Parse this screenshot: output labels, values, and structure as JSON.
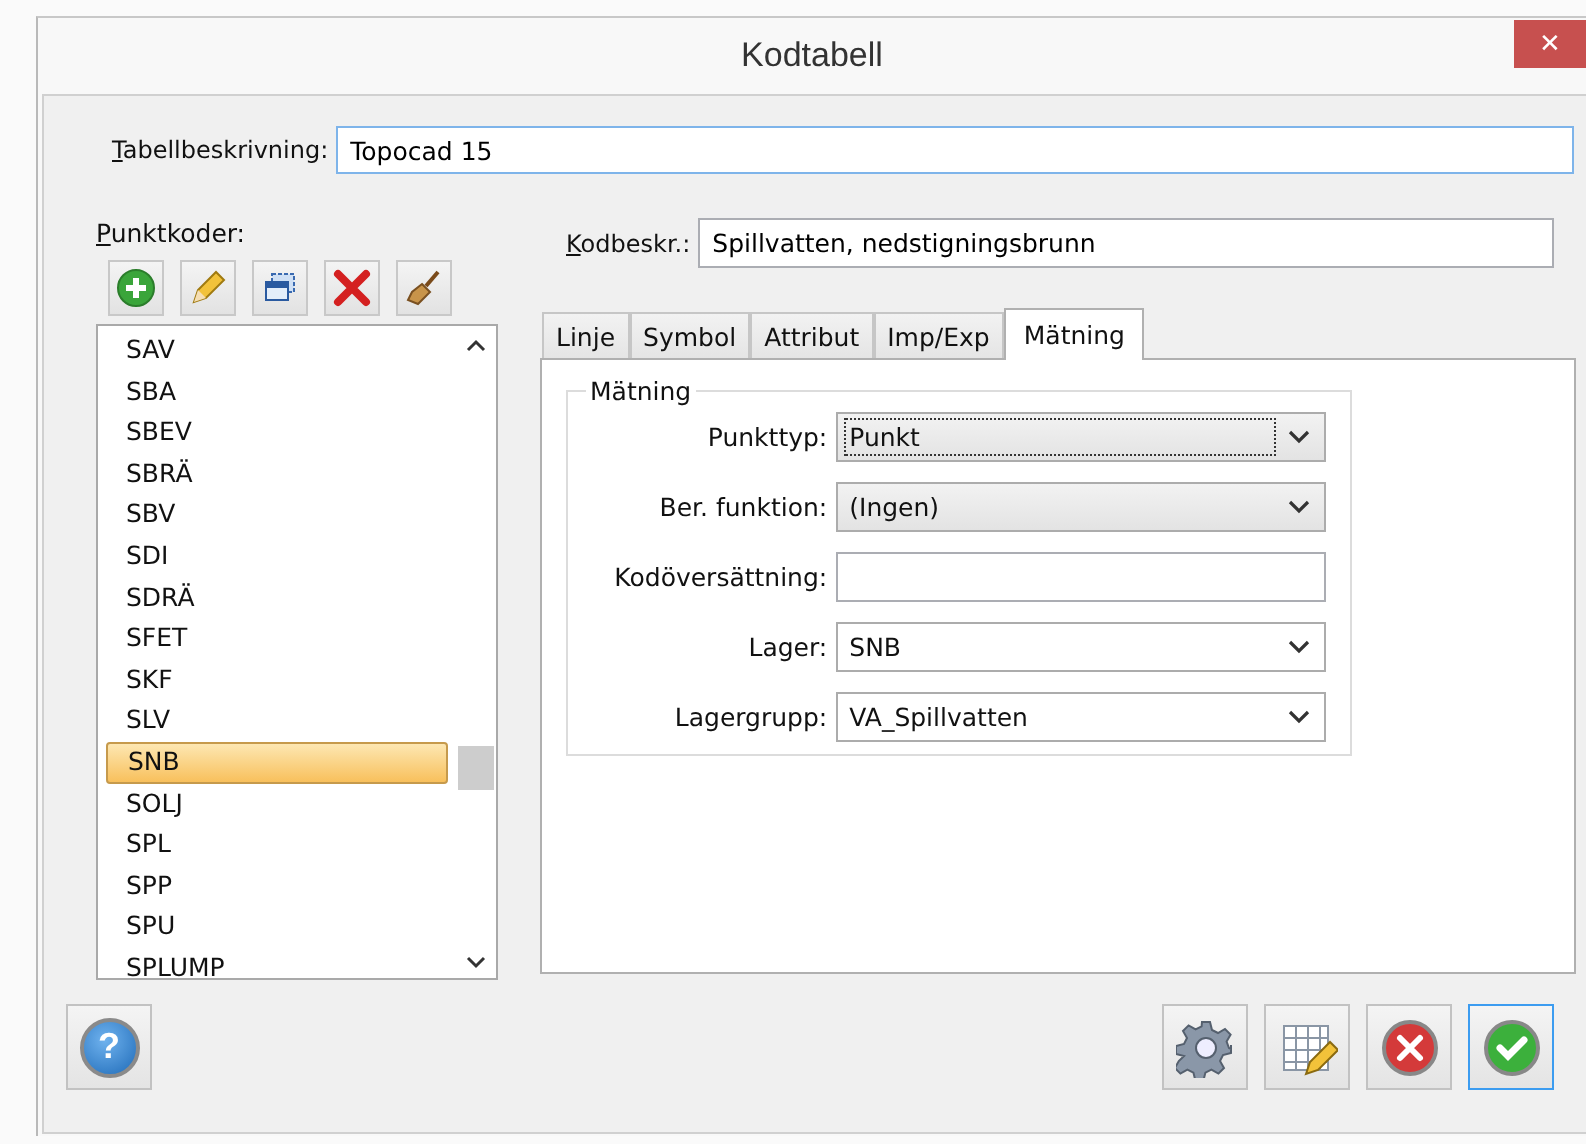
{
  "window": {
    "title": "Kodtabell",
    "close_glyph": "✕"
  },
  "table_description": {
    "label": "Tabellbeskrivning:",
    "value": "Topocad 15"
  },
  "point_codes": {
    "label": "Punktkoder:",
    "toolbar": [
      {
        "kind": "add"
      },
      {
        "kind": "edit"
      },
      {
        "kind": "copy"
      },
      {
        "kind": "delete"
      },
      {
        "kind": "clean"
      }
    ],
    "items": [
      {
        "code": "SAV",
        "selected": false
      },
      {
        "code": "SBA",
        "selected": false
      },
      {
        "code": "SBEV",
        "selected": false
      },
      {
        "code": "SBRÄ",
        "selected": false
      },
      {
        "code": "SBV",
        "selected": false
      },
      {
        "code": "SDI",
        "selected": false
      },
      {
        "code": "SDRÄ",
        "selected": false
      },
      {
        "code": "SFET",
        "selected": false
      },
      {
        "code": "SKF",
        "selected": false
      },
      {
        "code": "SLV",
        "selected": false
      },
      {
        "code": "SNB",
        "selected": true
      },
      {
        "code": "SOLJ",
        "selected": false
      },
      {
        "code": "SPL",
        "selected": false
      },
      {
        "code": "SPP",
        "selected": false
      },
      {
        "code": "SPU",
        "selected": false
      },
      {
        "code": "SPLUMP",
        "selected": false
      }
    ]
  },
  "code_description": {
    "label": "Kodbeskr.:",
    "value": "Spillvatten, nedstigningsbrunn"
  },
  "tabs": [
    {
      "label": "Linje",
      "selected": false
    },
    {
      "label": "Symbol",
      "selected": false
    },
    {
      "label": "Attribut",
      "selected": false
    },
    {
      "label": "Imp/Exp",
      "selected": false
    },
    {
      "label": "Mätning",
      "selected": true
    }
  ],
  "group": {
    "title": "Mätning",
    "fields": [
      {
        "kind": "select",
        "label": "Punkttyp:",
        "value": "Punkt",
        "focused": true
      },
      {
        "kind": "select",
        "label": "Ber. funktion:",
        "value": "(Ingen)",
        "focused": false
      },
      {
        "kind": "text",
        "label": "Kodöversättning:"
      },
      {
        "kind": "select",
        "label": "Lager:",
        "value": "SNB",
        "focused": false
      },
      {
        "kind": "select",
        "label": "Lagergrupp:",
        "value": "VA_Spillvatten",
        "focused": false
      }
    ]
  },
  "help_button": {
    "label": "?"
  },
  "buttons": [
    {
      "kind": "settings",
      "default": false
    },
    {
      "kind": "table",
      "default": false
    },
    {
      "kind": "cancel",
      "default": false
    },
    {
      "kind": "ok",
      "default": true
    }
  ]
}
